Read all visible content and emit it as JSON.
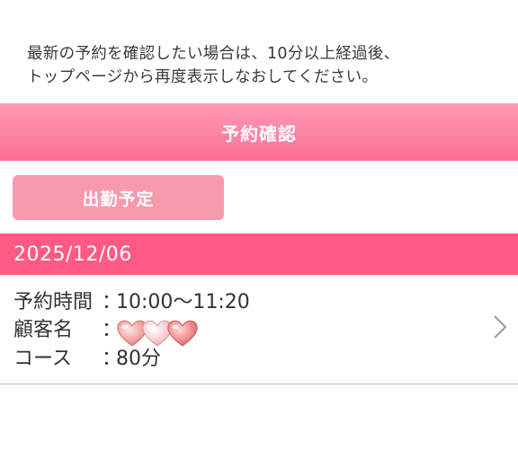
{
  "notice": {
    "line1": "最新の予約を確認したい場合は、10分以上経過後、",
    "line2": "トップページから再度表示しなおしてください。"
  },
  "header": {
    "title": "予約確認"
  },
  "shift_button": {
    "label": "出勤予定"
  },
  "reservation": {
    "date": "2025/12/06",
    "time_label": "予約時間",
    "time_value": "10:00〜11:20",
    "customer_label": "顧客名",
    "customer_value_icons": [
      "heart-icon",
      "heart-icon",
      "heart-icon"
    ],
    "course_label": "コース",
    "course_value": "80分",
    "separator": "："
  },
  "colors": {
    "header_gradient_top": "#ff9ab5",
    "header_gradient_bottom": "#fb6f95",
    "date_bar": "#ff5a84",
    "button": "#f79aae"
  }
}
